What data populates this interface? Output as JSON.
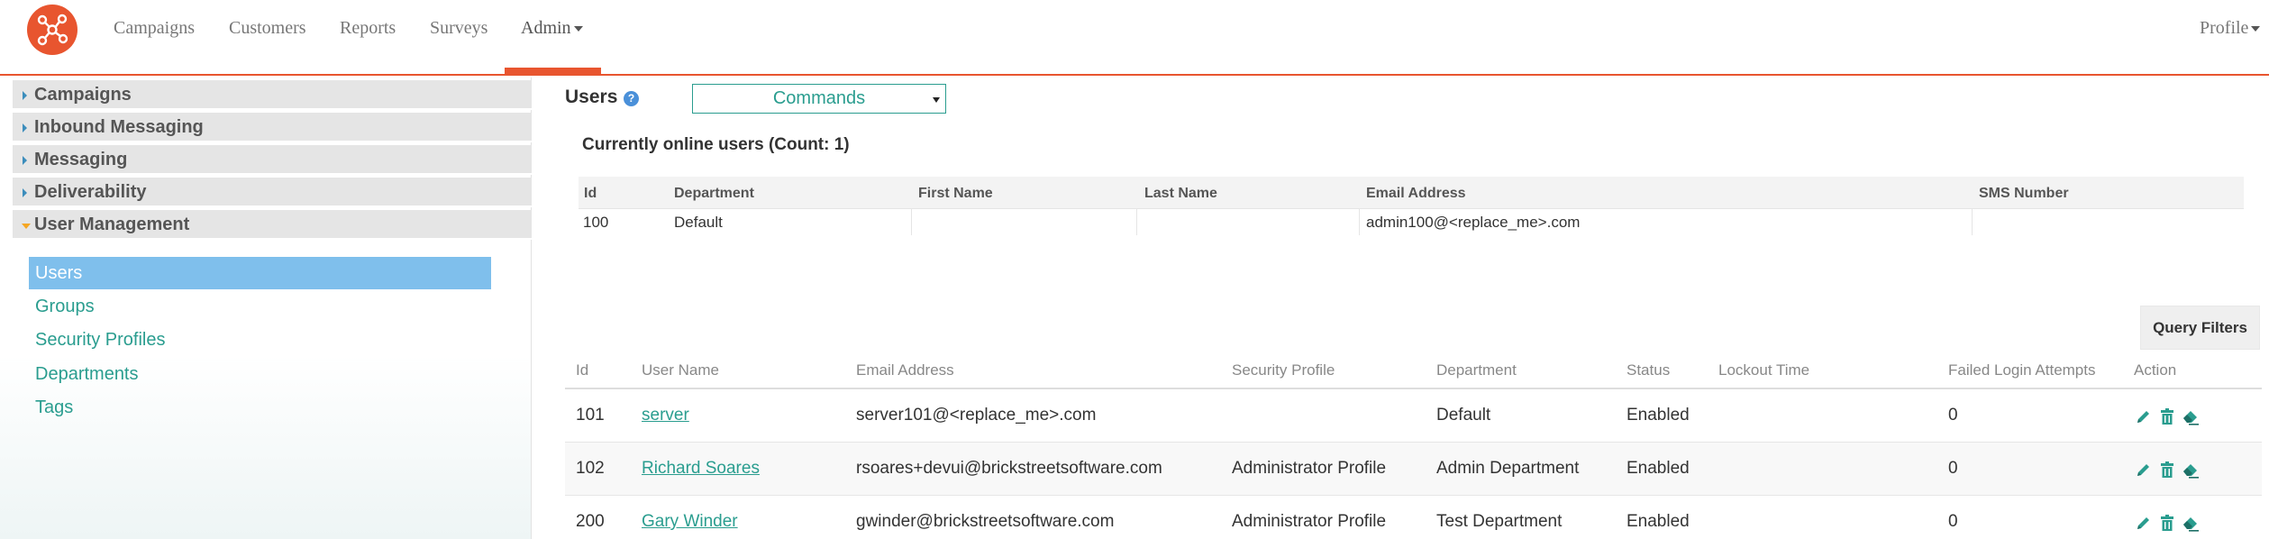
{
  "topnav": {
    "items": [
      {
        "label": "Campaigns"
      },
      {
        "label": "Customers"
      },
      {
        "label": "Reports"
      },
      {
        "label": "Surveys"
      },
      {
        "label": "Admin"
      }
    ],
    "active": "Admin",
    "profile_label": "Profile",
    "accent_color": "#e8552f"
  },
  "sidebar": {
    "sections": [
      {
        "label": "Campaigns"
      },
      {
        "label": "Inbound Messaging"
      },
      {
        "label": "Messaging"
      },
      {
        "label": "Deliverability"
      },
      {
        "label": "User Management"
      }
    ],
    "sub_items": [
      {
        "label": "Users"
      },
      {
        "label": "Groups"
      },
      {
        "label": "Security Profiles"
      },
      {
        "label": "Departments"
      },
      {
        "label": "Tags"
      }
    ],
    "active_sub_item": "Users"
  },
  "main": {
    "title": "Users",
    "help_icon": "?",
    "commands_label": "Commands",
    "online": {
      "heading": "Currently online users (Count: 1)",
      "columns": [
        "Id",
        "Department",
        "First Name",
        "Last Name",
        "Email Address",
        "SMS Number"
      ],
      "rows": [
        [
          "100",
          "Default",
          "",
          "",
          "admin100@<replace_me>.com",
          ""
        ]
      ]
    },
    "query_filters_label": "Query Filters",
    "users": {
      "columns": [
        "Id",
        "User Name",
        "Email Address",
        "Security Profile",
        "Department",
        "Status",
        "Lockout Time",
        "Failed Login Attempts",
        "Action"
      ],
      "rows": [
        {
          "id": "101",
          "user_name": "server",
          "email": "server101@<replace_me>.com",
          "security_profile": "",
          "department": "Default",
          "status": "Enabled",
          "lockout_time": "",
          "failed": "0"
        },
        {
          "id": "102",
          "user_name": "Richard Soares",
          "email": "rsoares+devui@brickstreetsoftware.com",
          "security_profile": "Administrator Profile",
          "department": "Admin Department",
          "status": "Enabled",
          "lockout_time": "",
          "failed": "0"
        },
        {
          "id": "200",
          "user_name": "Gary Winder",
          "email": "gwinder@brickstreetsoftware.com",
          "security_profile": "Administrator Profile",
          "department": "Test Department",
          "status": "Enabled",
          "lockout_time": "",
          "failed": "0"
        }
      ],
      "action_icons": [
        "pencil-icon",
        "trash-icon",
        "eraser-icon"
      ]
    }
  }
}
